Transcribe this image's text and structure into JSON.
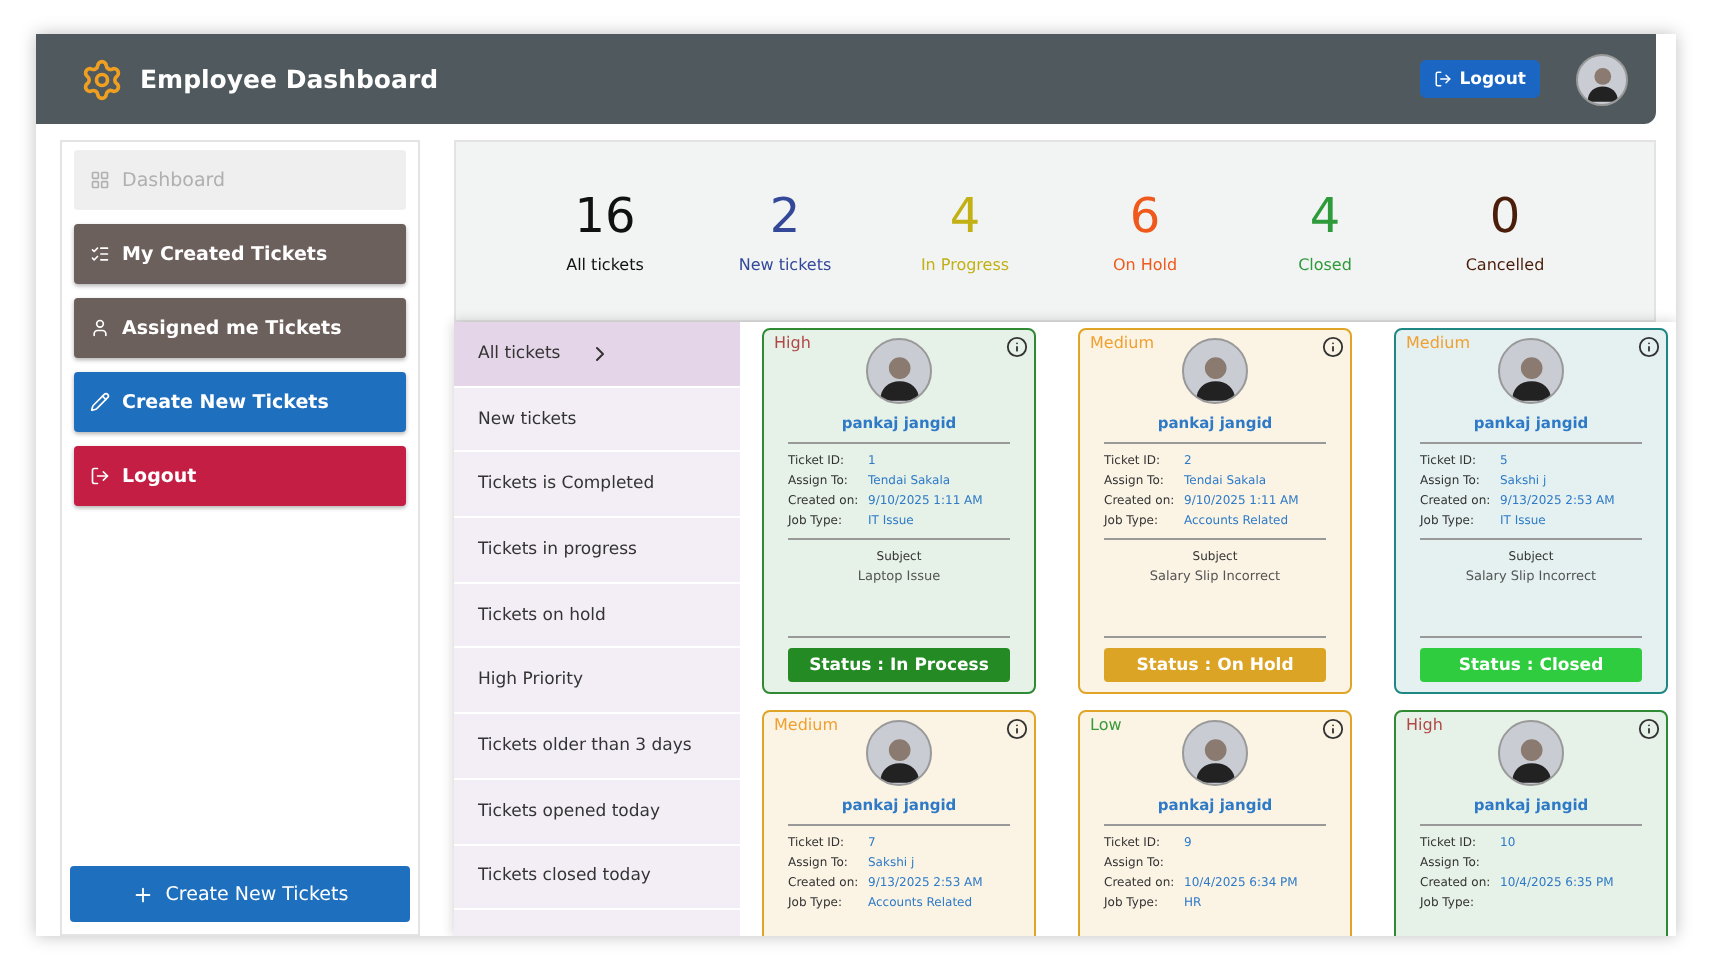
{
  "header": {
    "title": "Employee Dashboard",
    "logout": "Logout"
  },
  "sidebar": {
    "items": [
      {
        "label": "Dashboard",
        "kind": "dashboard",
        "disabled": true
      },
      {
        "label": "My Created Tickets",
        "kind": "list",
        "disabled": false
      },
      {
        "label": "Assigned me Tickets",
        "kind": "user",
        "disabled": false
      },
      {
        "label": "Create New Tickets",
        "kind": "create",
        "disabled": false
      },
      {
        "label": "Logout",
        "kind": "logout",
        "disabled": false
      }
    ],
    "bottom_button": "Create New Tickets"
  },
  "stats": [
    {
      "value": "16",
      "label": "All tickets",
      "color": "#111111"
    },
    {
      "value": "2",
      "label": "New tickets",
      "color": "#34489a"
    },
    {
      "value": "4",
      "label": "In Progress",
      "color": "#c2b014"
    },
    {
      "value": "6",
      "label": "On Hold",
      "color": "#ef5a1c"
    },
    {
      "value": "4",
      "label": "Closed",
      "color": "#2f9a3a"
    },
    {
      "value": "0",
      "label": "Cancelled",
      "color": "#4a1e0a"
    }
  ],
  "filters": [
    {
      "label": "All tickets",
      "selected": true
    },
    {
      "label": "New tickets",
      "selected": false
    },
    {
      "label": "Tickets is Completed",
      "selected": false
    },
    {
      "label": "Tickets in progress",
      "selected": false
    },
    {
      "label": "Tickets on hold",
      "selected": false
    },
    {
      "label": "High Priority",
      "selected": false
    },
    {
      "label": "Tickets older than 3 days",
      "selected": false
    },
    {
      "label": "Tickets opened today",
      "selected": false
    },
    {
      "label": "Tickets closed today",
      "selected": false
    }
  ],
  "cards": [
    {
      "color": "#2f8a33",
      "priority": {
        "label": "High",
        "kind": "high"
      },
      "name": "pankaj jangid",
      "fields": [
        {
          "label": "Ticket ID:",
          "value": "1"
        },
        {
          "label": "Assign To:",
          "value": "Tendai Sakala"
        },
        {
          "label": "Created on:",
          "value": "9/10/2025 1:11 AM"
        },
        {
          "label": "Job Type:",
          "value": "IT Issue"
        }
      ],
      "subject_label": "Subject",
      "subject": "Laptop Issue",
      "status": {
        "label": "Status : In Process",
        "kind": "in_process"
      }
    },
    {
      "color": "#e0a526",
      "priority": {
        "label": "Medium",
        "kind": "medium"
      },
      "name": "pankaj jangid",
      "fields": [
        {
          "label": "Ticket ID:",
          "value": "2"
        },
        {
          "label": "Assign To:",
          "value": "Tendai Sakala"
        },
        {
          "label": "Created on:",
          "value": "9/10/2025 1:11 AM"
        },
        {
          "label": "Job Type:",
          "value": "Accounts Related"
        }
      ],
      "subject_label": "Subject",
      "subject": "Salary Slip Incorrect",
      "status": {
        "label": "Status : On Hold",
        "kind": "on_hold"
      }
    },
    {
      "color": "#1e8784",
      "priority": {
        "label": "Medium",
        "kind": "medium"
      },
      "name": "pankaj jangid",
      "fields": [
        {
          "label": "Ticket ID:",
          "value": "5"
        },
        {
          "label": "Assign To:",
          "value": "Sakshi j"
        },
        {
          "label": "Created on:",
          "value": "9/13/2025 2:53 AM"
        },
        {
          "label": "Job Type:",
          "value": "IT Issue"
        }
      ],
      "subject_label": "Subject",
      "subject": "Salary Slip Incorrect",
      "status": {
        "label": "Status : Closed",
        "kind": "closed"
      }
    },
    {
      "color": "#e0a526",
      "priority": {
        "label": "Medium",
        "kind": "medium"
      },
      "name": "pankaj jangid",
      "fields": [
        {
          "label": "Ticket ID:",
          "value": "7"
        },
        {
          "label": "Assign To:",
          "value": "Sakshi j"
        },
        {
          "label": "Created on:",
          "value": "9/13/2025 2:53 AM"
        },
        {
          "label": "Job Type:",
          "value": "Accounts Related"
        }
      ]
    },
    {
      "color": "#e0a526",
      "priority": {
        "label": "Low",
        "kind": "low"
      },
      "name": "pankaj jangid",
      "fields": [
        {
          "label": "Ticket ID:",
          "value": "9"
        },
        {
          "label": "Assign To:"
        },
        {
          "label": "Created on:",
          "value": "10/4/2025 6:34 PM"
        },
        {
          "label": "Job Type:",
          "value": "HR"
        }
      ]
    },
    {
      "color": "#2f8a33",
      "priority": {
        "label": "High",
        "kind": "high"
      },
      "name": "pankaj jangid",
      "fields": [
        {
          "label": "Ticket ID:",
          "value": "10"
        },
        {
          "label": "Assign To:"
        },
        {
          "label": "Created on:",
          "value": "10/4/2025 6:35 PM"
        },
        {
          "label": "Job Type:"
        }
      ]
    }
  ]
}
